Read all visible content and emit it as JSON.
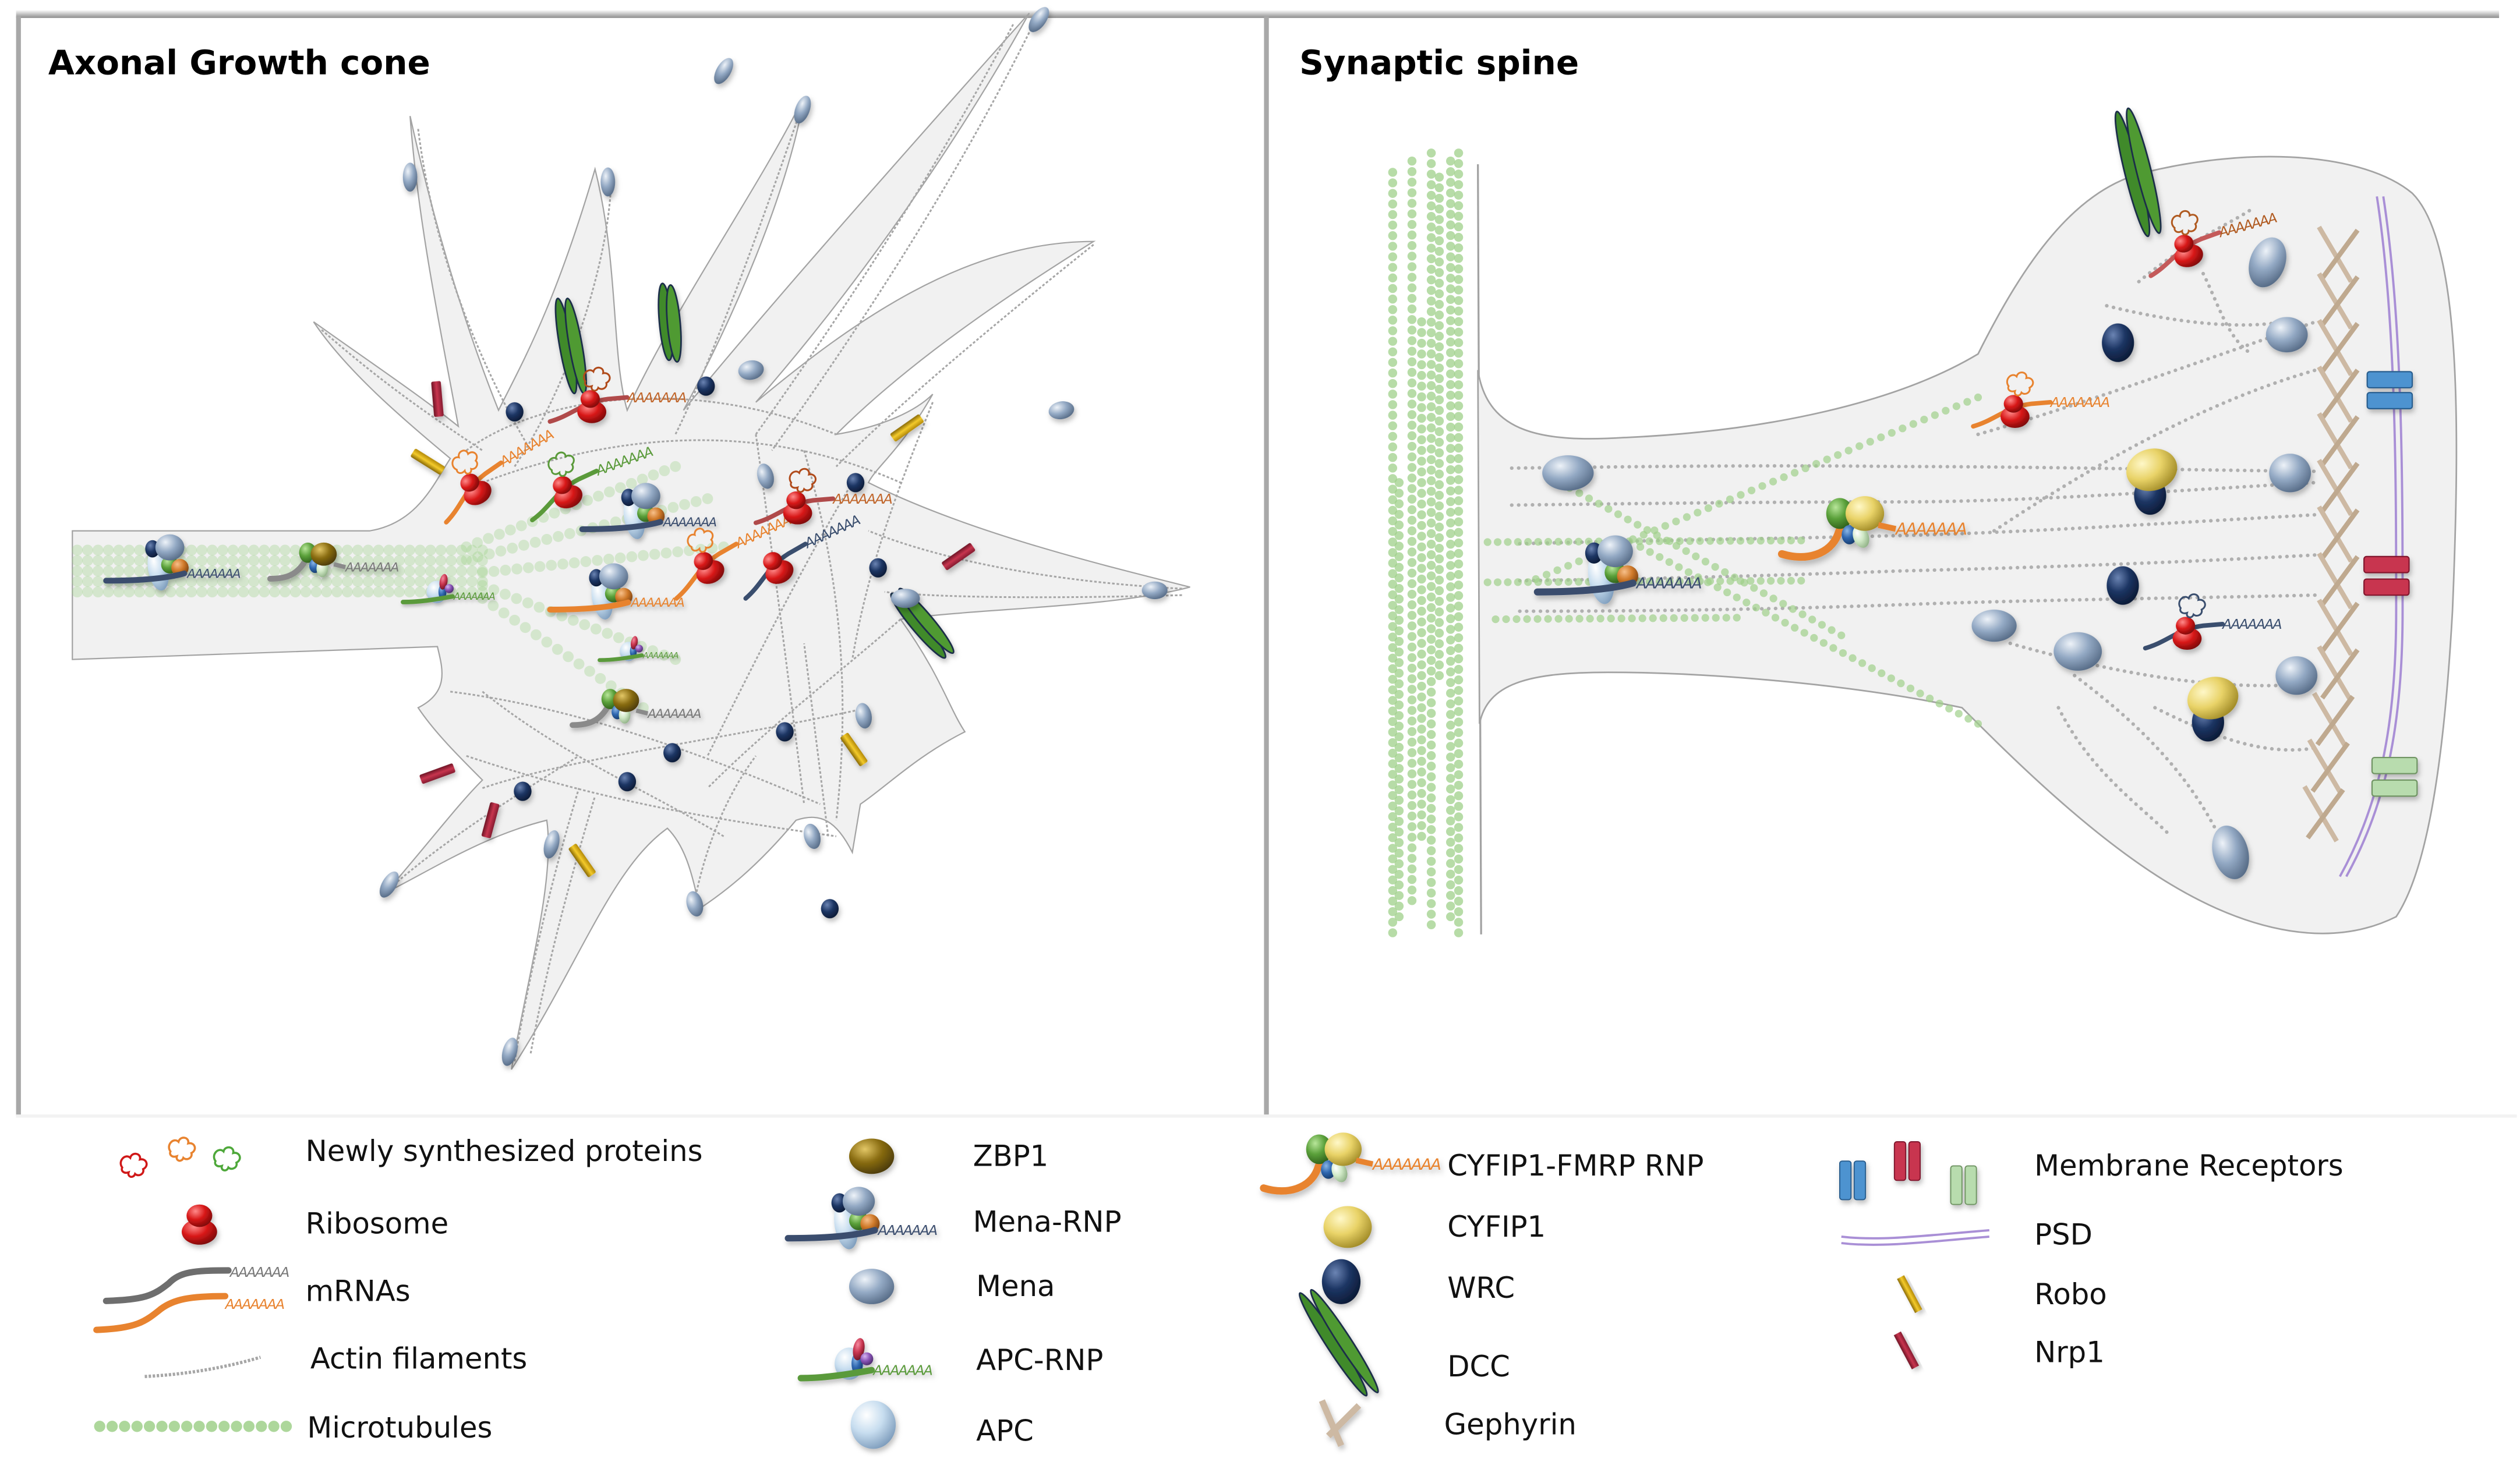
{
  "figure": {
    "panels": [
      {
        "id": "axonal-growth-cone",
        "title": "Axonal Growth cone"
      },
      {
        "id": "synaptic-spine",
        "title": "Synaptic spine"
      }
    ],
    "poly_a_tail": "AAAAAAA",
    "legend": {
      "column1": [
        {
          "icon": "newly-synthesized-proteins-icon",
          "label": "Newly synthesized proteins"
        },
        {
          "icon": "ribosome-icon",
          "label": "Ribosome"
        },
        {
          "icon": "mrnas-icon",
          "label": "mRNAs"
        },
        {
          "icon": "actin-filaments-icon",
          "label": "Actin filaments"
        },
        {
          "icon": "microtubules-icon",
          "label": "Microtubules"
        }
      ],
      "column2": [
        {
          "icon": "zbp1-icon",
          "label": "ZBP1"
        },
        {
          "icon": "mena-rnp-icon",
          "label": "Mena-RNP"
        },
        {
          "icon": "mena-icon",
          "label": "Mena"
        },
        {
          "icon": "apc-rnp-icon",
          "label": "APC-RNP"
        },
        {
          "icon": "apc-icon",
          "label": "APC"
        }
      ],
      "column3": [
        {
          "icon": "cyfip1-fmrp-rnp-icon",
          "label": "CYFIP1-FMRP RNP"
        },
        {
          "icon": "cyfip1-icon",
          "label": "CYFIP1"
        },
        {
          "icon": "wrc-icon",
          "label": "WRC"
        },
        {
          "icon": "dcc-icon",
          "label": "DCC"
        },
        {
          "icon": "gephyrin-icon",
          "label": "Gephyrin"
        }
      ],
      "column4": [
        {
          "icon": "membrane-receptors-icon",
          "label": "Membrane Receptors"
        },
        {
          "icon": "psd-icon",
          "label": "PSD"
        },
        {
          "icon": "robo-icon",
          "label": "Robo"
        },
        {
          "icon": "nrp1-icon",
          "label": "Nrp1"
        }
      ]
    },
    "colors": {
      "cell_fill": "#f1f1f1",
      "cell_outline": "#9a9a9a",
      "ribosome": "#d81818",
      "mena": "#93a9c4",
      "wrc": "#1c3563",
      "zbp1": "#8a6d12",
      "cyfip1": "#e9d368",
      "apc": "#c7ddef",
      "dcc": "#3f8a2a",
      "robo": "#e0b318",
      "nrp1": "#a8253f",
      "gephyrin": "#cdb9a3",
      "psd": "#a98fd6",
      "microtubule": "#9fd08a",
      "actin": "#a0a0a0",
      "mrna_gray": "#6e6e6e",
      "mrna_orange": "#e8832f",
      "mrna_green": "#5a9a3a",
      "mrna_navy": "#3a4e6e",
      "receptor_blue": "#4d93d0",
      "receptor_red": "#c8354f",
      "receptor_green": "#b8dcae"
    }
  }
}
